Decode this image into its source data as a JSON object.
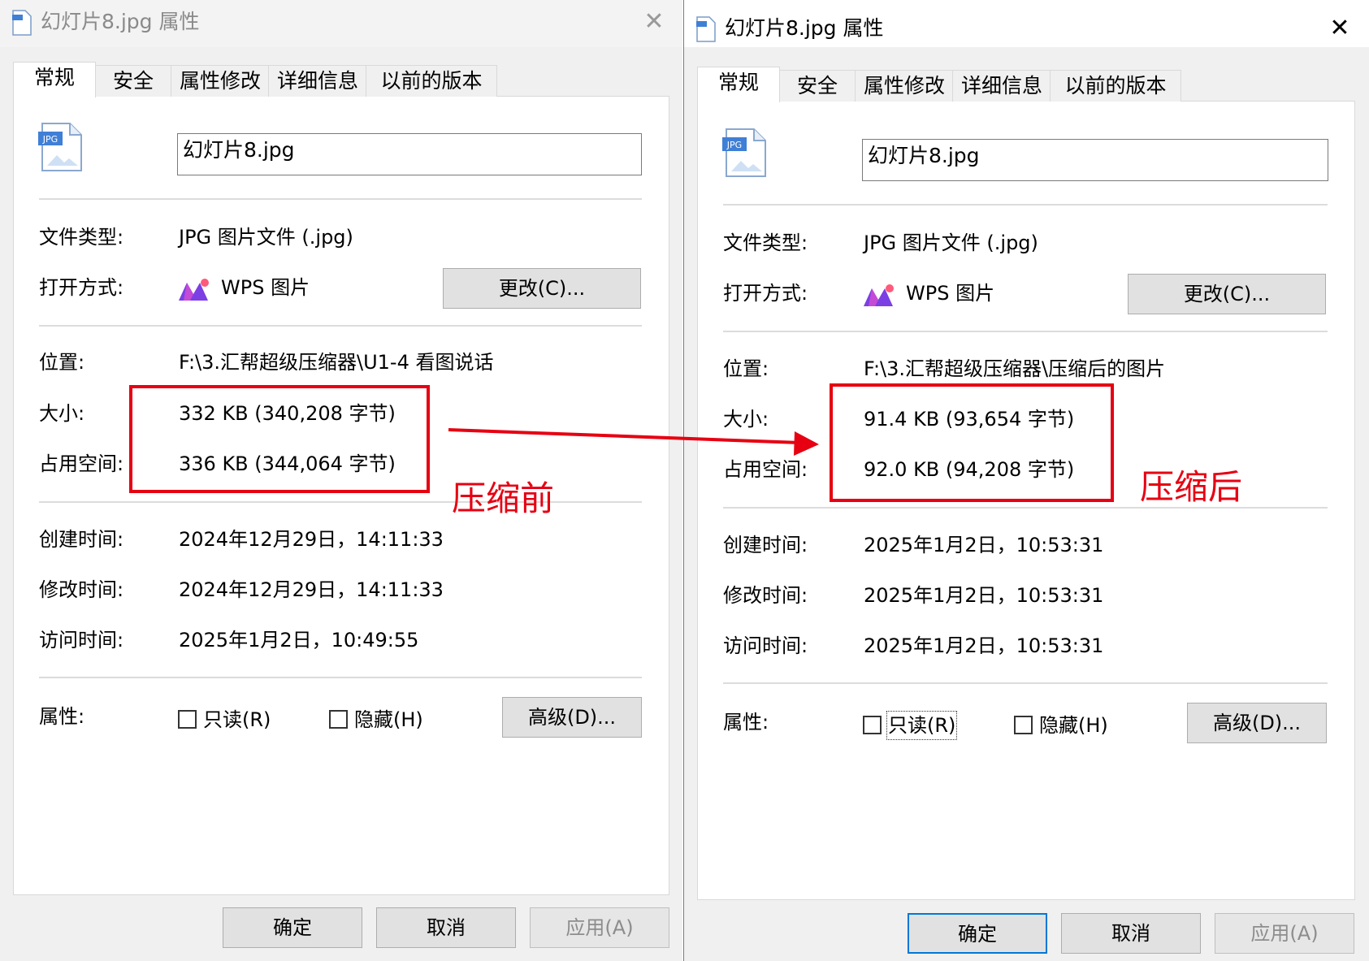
{
  "left": {
    "title": "幻灯片8.jpg 属性",
    "tabs": [
      "常规",
      "安全",
      "属性修改",
      "详细信息",
      "以前的版本"
    ],
    "file_name": "幻灯片8.jpg",
    "labels": {
      "type": "文件类型:",
      "open": "打开方式:",
      "location": "位置:",
      "size": "大小:",
      "disk": "占用空间:",
      "created": "创建时间:",
      "modified": "修改时间:",
      "accessed": "访问时间:",
      "attrs": "属性:"
    },
    "values": {
      "type": "JPG 图片文件 (.jpg)",
      "open_app": "WPS 图片",
      "location": "F:\\3.汇帮超级压缩器\\U1-4 看图说话",
      "size": "332 KB (340,208 字节)",
      "disk": "336 KB (344,064 字节)",
      "created": "2024年12月29日，14:11:33",
      "modified": "2024年12月29日，14:11:33",
      "accessed": "2025年1月2日，10:49:55"
    },
    "change_btn": "更改(C)...",
    "readonly": "只读(R)",
    "hidden": "隐藏(H)",
    "advanced_btn": "高级(D)...",
    "ok": "确定",
    "cancel": "取消",
    "apply": "应用(A)",
    "annotation": "压缩前"
  },
  "right": {
    "title": "幻灯片8.jpg 属性",
    "tabs": [
      "常规",
      "安全",
      "属性修改",
      "详细信息",
      "以前的版本"
    ],
    "file_name": "幻灯片8.jpg",
    "labels": {
      "type": "文件类型:",
      "open": "打开方式:",
      "location": "位置:",
      "size": "大小:",
      "disk": "占用空间:",
      "created": "创建时间:",
      "modified": "修改时间:",
      "accessed": "访问时间:",
      "attrs": "属性:"
    },
    "values": {
      "type": "JPG 图片文件 (.jpg)",
      "open_app": "WPS 图片",
      "location": "F:\\3.汇帮超级压缩器\\压缩后的图片",
      "size": "91.4 KB (93,654 字节)",
      "disk": "92.0 KB (94,208 字节)",
      "created": "2025年1月2日，10:53:31",
      "modified": "2025年1月2日，10:53:31",
      "accessed": "2025年1月2日，10:53:31"
    },
    "change_btn": "更改(C)...",
    "readonly": "只读(R)",
    "hidden": "隐藏(H)",
    "advanced_btn": "高级(D)...",
    "ok": "确定",
    "cancel": "取消",
    "apply": "应用(A)",
    "annotation": "压缩后"
  },
  "icons": {
    "file": "jpg-file-icon",
    "app": "wps-pictures-icon",
    "close": "close-icon",
    "title": "file-icon"
  },
  "icon_text": {
    "jpg_badge": "JPG"
  },
  "colors": {
    "annotation_red": "#e60012",
    "default_button_border": "#0078d7",
    "window_bg": "#f0f0f0"
  }
}
